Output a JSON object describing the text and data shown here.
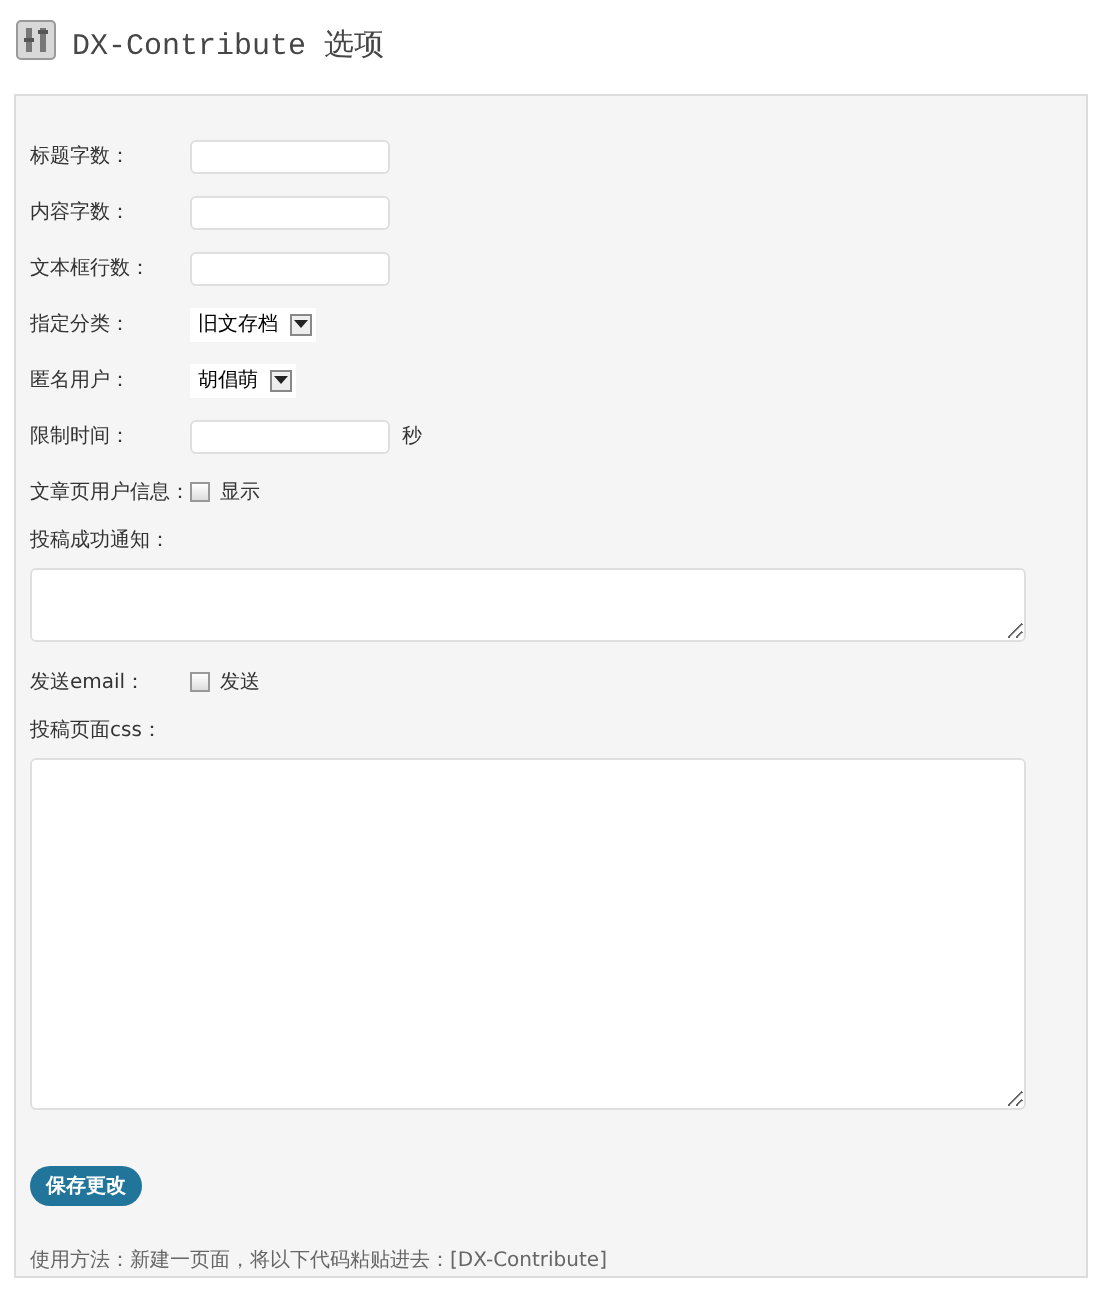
{
  "page": {
    "title": "DX-Contribute 选项"
  },
  "fields": [
    {
      "kind": "text",
      "label": "标题字数："
    },
    {
      "kind": "text",
      "label": "内容字数："
    },
    {
      "kind": "text",
      "label": "文本框行数："
    },
    {
      "kind": "select",
      "label": "指定分类：",
      "value": "旧文存档"
    },
    {
      "kind": "select",
      "label": "匿名用户：",
      "value": "胡倡萌"
    },
    {
      "kind": "text",
      "label": "限制时间：",
      "suffix": "秒"
    },
    {
      "kind": "checkbox",
      "label": "文章页用户信息：",
      "option": "显示",
      "checked": false
    },
    {
      "kind": "textarea",
      "label": "投稿成功通知："
    },
    {
      "kind": "checkbox",
      "label": "发送email：",
      "option": "发送",
      "checked": false
    },
    {
      "kind": "textarea",
      "label": "投稿页面css："
    }
  ],
  "save_button": "保存更改",
  "usage": "使用方法：新建一页面，将以下代码粘贴进去：[DX-Contribute]"
}
